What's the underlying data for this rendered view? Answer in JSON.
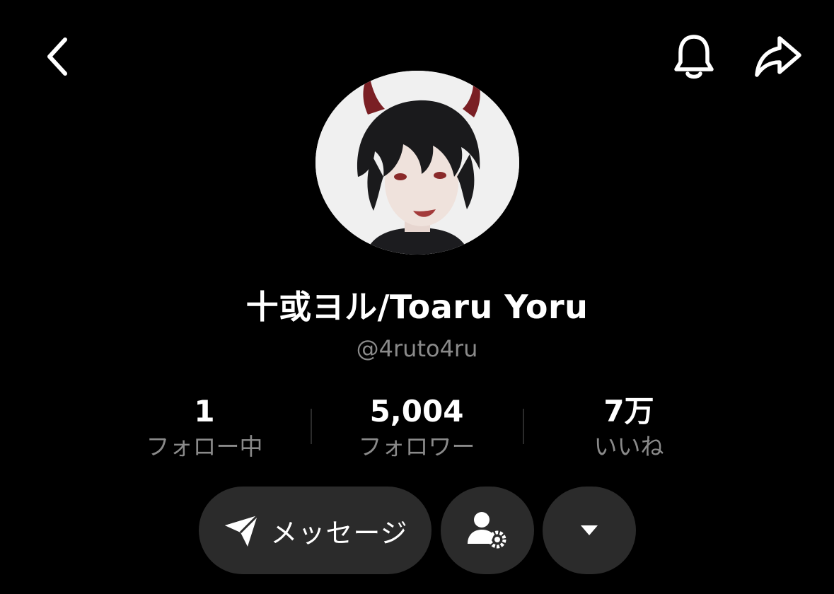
{
  "profile": {
    "display_name": "十或ヨル/Toaru Yoru",
    "handle": "@4ruto4ru"
  },
  "stats": [
    {
      "value": "1",
      "label": "フォロー中"
    },
    {
      "value": "5,004",
      "label": "フォロワー"
    },
    {
      "value": "7万",
      "label": "いいね"
    }
  ],
  "actions": {
    "message_label": "メッセージ"
  },
  "icons": {
    "back": "chevron-left-icon",
    "notifications": "bell-icon",
    "share": "share-arrow-icon",
    "message": "paper-plane-icon",
    "friend_settings": "user-gear-icon",
    "more": "caret-down-icon"
  },
  "colors": {
    "background": "#000000",
    "text_primary": "#ffffff",
    "text_secondary": "#8a8a8a",
    "button_bg": "#2b2b2b"
  }
}
